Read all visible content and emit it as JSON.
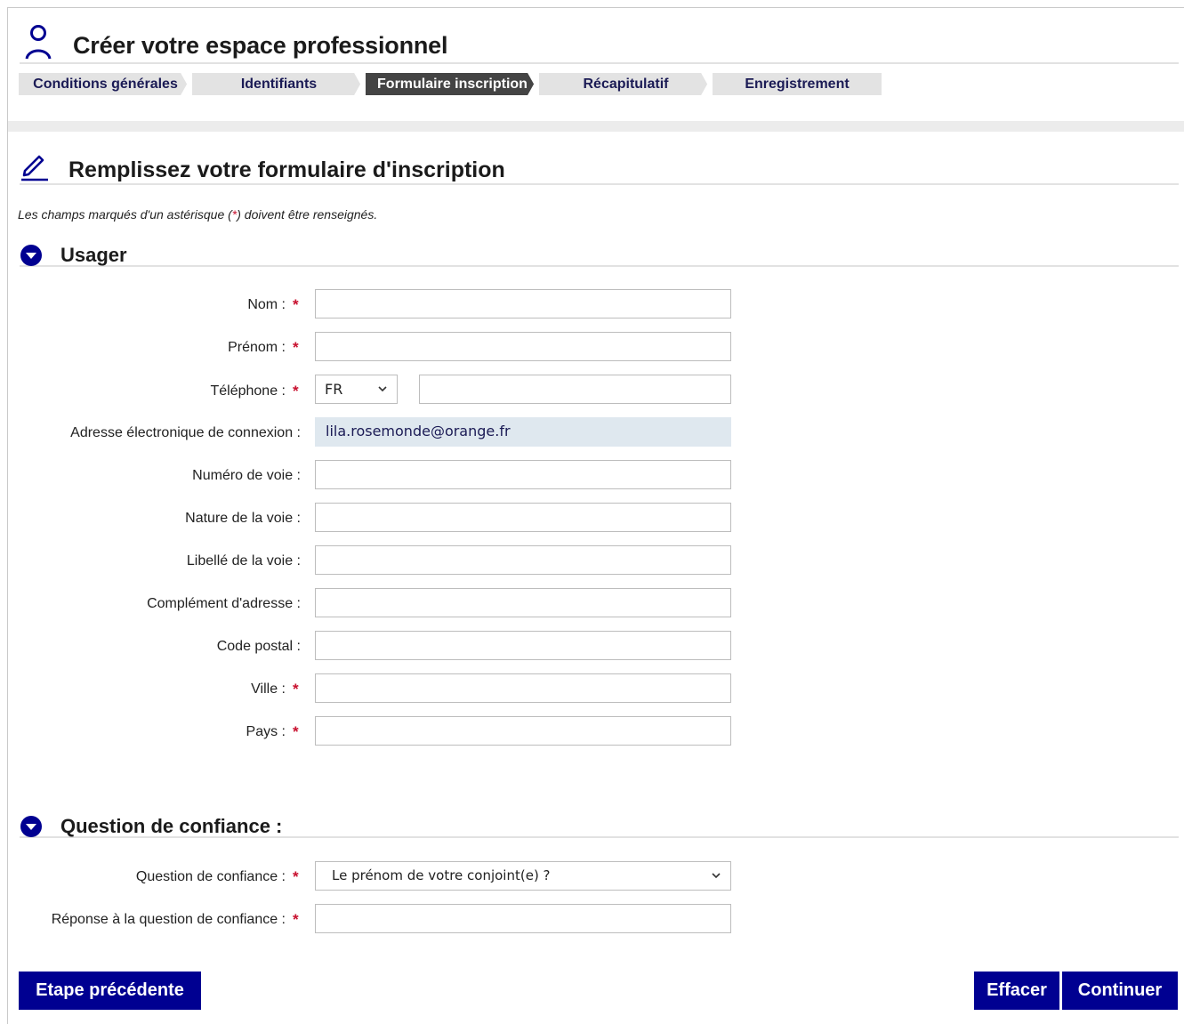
{
  "header": {
    "title": "Créer votre espace professionnel"
  },
  "stepper": {
    "steps": [
      {
        "label": "Conditions générales",
        "active": false
      },
      {
        "label": "Identifiants",
        "active": false
      },
      {
        "label": "Formulaire inscription",
        "active": true
      },
      {
        "label": "Récapitulatif",
        "active": false
      },
      {
        "label": "Enregistrement",
        "active": false
      }
    ]
  },
  "form": {
    "title": "Remplissez votre formulaire d'inscription",
    "note_before": "Les champs marqués d'un astérisque (",
    "note_star": "*",
    "note_after": ") doivent être renseignés."
  },
  "usager": {
    "section_title": "Usager",
    "fields": [
      {
        "label": "Nom :",
        "required": true,
        "value": ""
      },
      {
        "label": "Prénom :",
        "required": true,
        "value": ""
      },
      {
        "label": "Téléphone :",
        "required": true,
        "country": "FR",
        "value": ""
      },
      {
        "label": "Adresse électronique de connexion :",
        "required": false,
        "value": "lila.rosemonde@orange.fr"
      },
      {
        "label": "Numéro de voie :",
        "required": false,
        "value": ""
      },
      {
        "label": "Nature de la voie :",
        "required": false,
        "value": ""
      },
      {
        "label": "Libellé de la voie :",
        "required": false,
        "value": ""
      },
      {
        "label": "Complément d'adresse :",
        "required": false,
        "value": ""
      },
      {
        "label": "Code postal :",
        "required": false,
        "value": ""
      },
      {
        "label": "Ville :",
        "required": true,
        "value": ""
      },
      {
        "label": "Pays :",
        "required": true,
        "value": ""
      }
    ],
    "required_mark": "*"
  },
  "confiance": {
    "section_title": "Question de confiance :",
    "question_label": "Question de confiance :",
    "question_value": "Le prénom de votre conjoint(e) ?",
    "answer_label": "Réponse à la question de confiance :",
    "answer_value": ""
  },
  "buttons": {
    "previous": "Etape précédente",
    "clear": "Effacer",
    "continue": "Continuer"
  },
  "colors": {
    "primary": "#000091",
    "required": "#c8102e",
    "active_step": "#444444",
    "readonly_bg": "#dfe8ef"
  }
}
